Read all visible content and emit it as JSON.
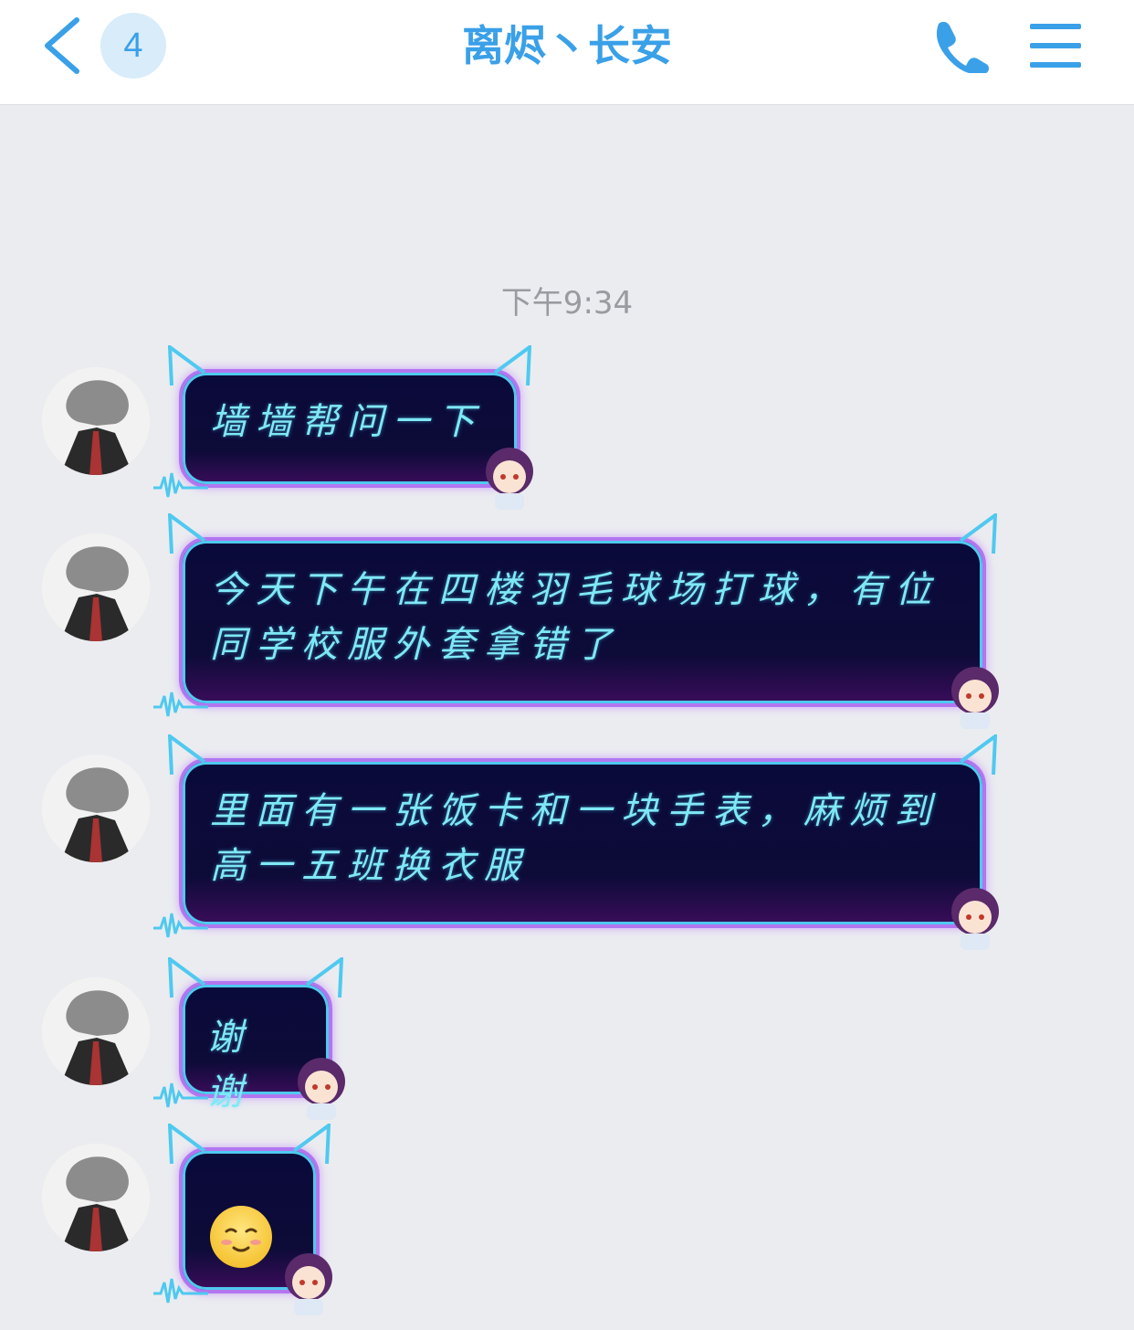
{
  "header": {
    "back_badge": "4",
    "title": "离烬丶长安"
  },
  "chat": {
    "timestamp": "下午9:34",
    "messages": [
      {
        "text": "墙墙帮问一下"
      },
      {
        "text": "今天下午在四楼羽毛球场打球，有位同学校服外套拿错了"
      },
      {
        "text": "里面有一张饭卡和一块手表，麻烦到高一五班换衣服"
      },
      {
        "text": "谢谢"
      },
      {
        "emoji": "smile-blush-emoji"
      }
    ]
  },
  "colors": {
    "accent": "#3aa0e8",
    "background": "#ebecf0",
    "bubble_text": "#7fe8f5"
  }
}
